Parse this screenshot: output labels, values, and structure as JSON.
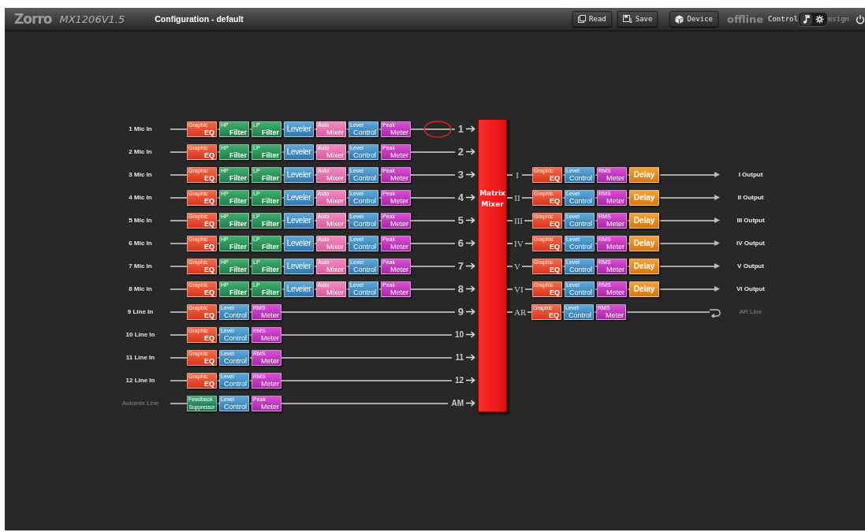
{
  "header": {
    "logo": "Zorro",
    "model": "MX1206V1.5",
    "title": "Configuration - default",
    "buttons": [
      {
        "kind": "read",
        "label": "Read"
      },
      {
        "kind": "save",
        "label": "Save"
      },
      {
        "kind": "device",
        "label": "Device"
      }
    ],
    "status": "offline",
    "mode_label": "Control",
    "toggle": [
      {
        "kind": "note",
        "selected": true
      },
      {
        "kind": "gear",
        "selected": false
      }
    ],
    "hidden_mode_label": "esign"
  },
  "inputs": [
    {
      "label": "1 Mic In",
      "number": "1",
      "circled": true,
      "dim": false,
      "blocks": [
        {
          "kind": "eq",
          "small": "Graphic",
          "big": "EQ"
        },
        {
          "kind": "filter",
          "small": "HP",
          "big": "Filter"
        },
        {
          "kind": "filter",
          "small": "LP",
          "big": "Filter"
        },
        {
          "kind": "leveler",
          "big": "Leveler"
        },
        {
          "kind": "auto",
          "small": "Auto",
          "big": "Mixer"
        },
        {
          "kind": "level",
          "small": "Level",
          "big": "Control"
        },
        {
          "kind": "meter",
          "small": "Peak",
          "big": "Meter"
        }
      ]
    },
    {
      "label": "2 Mic In",
      "number": "2",
      "circled": false,
      "dim": false,
      "blocks": [
        {
          "kind": "eq",
          "small": "Graphic",
          "big": "EQ"
        },
        {
          "kind": "filter",
          "small": "HP",
          "big": "Filter"
        },
        {
          "kind": "filter",
          "small": "LP",
          "big": "Filter"
        },
        {
          "kind": "leveler",
          "big": "Leveler"
        },
        {
          "kind": "auto",
          "small": "Auto",
          "big": "Mixer"
        },
        {
          "kind": "level",
          "small": "Level",
          "big": "Control"
        },
        {
          "kind": "meter",
          "small": "Peak",
          "big": "Meter"
        }
      ]
    },
    {
      "label": "3 Mic In",
      "number": "3",
      "circled": false,
      "dim": false,
      "blocks": [
        {
          "kind": "eq",
          "small": "Graphic",
          "big": "EQ"
        },
        {
          "kind": "filter",
          "small": "HP",
          "big": "Filter"
        },
        {
          "kind": "filter",
          "small": "LP",
          "big": "Filter"
        },
        {
          "kind": "leveler",
          "big": "Leveler"
        },
        {
          "kind": "auto",
          "small": "Auto",
          "big": "Mixer"
        },
        {
          "kind": "level",
          "small": "Level",
          "big": "Control"
        },
        {
          "kind": "meter",
          "small": "Peak",
          "big": "Meter"
        }
      ]
    },
    {
      "label": "4 Mic In",
      "number": "4",
      "circled": false,
      "dim": false,
      "blocks": [
        {
          "kind": "eq",
          "small": "Graphic",
          "big": "EQ"
        },
        {
          "kind": "filter",
          "small": "HP",
          "big": "Filter"
        },
        {
          "kind": "filter",
          "small": "LP",
          "big": "Filter"
        },
        {
          "kind": "leveler",
          "big": "Leveler"
        },
        {
          "kind": "auto",
          "small": "Auto",
          "big": "Mixer"
        },
        {
          "kind": "level",
          "small": "Level",
          "big": "Control"
        },
        {
          "kind": "meter",
          "small": "Peak",
          "big": "Meter"
        }
      ]
    },
    {
      "label": "5 Mic In",
      "number": "5",
      "circled": false,
      "dim": false,
      "blocks": [
        {
          "kind": "eq",
          "small": "Graphic",
          "big": "EQ"
        },
        {
          "kind": "filter",
          "small": "HP",
          "big": "Filter"
        },
        {
          "kind": "filter",
          "small": "LP",
          "big": "Filter"
        },
        {
          "kind": "leveler",
          "big": "Leveler"
        },
        {
          "kind": "auto",
          "small": "Auto",
          "big": "Mixer"
        },
        {
          "kind": "level",
          "small": "Level",
          "big": "Control"
        },
        {
          "kind": "meter",
          "small": "Peak",
          "big": "Meter"
        }
      ]
    },
    {
      "label": "6 Mic In",
      "number": "6",
      "circled": false,
      "dim": false,
      "blocks": [
        {
          "kind": "eq",
          "small": "Graphic",
          "big": "EQ"
        },
        {
          "kind": "filter",
          "small": "HP",
          "big": "Filter"
        },
        {
          "kind": "filter",
          "small": "LP",
          "big": "Filter"
        },
        {
          "kind": "leveler",
          "big": "Leveler"
        },
        {
          "kind": "auto",
          "small": "Auto",
          "big": "Mixer"
        },
        {
          "kind": "level",
          "small": "Level",
          "big": "Control"
        },
        {
          "kind": "meter",
          "small": "Peak",
          "big": "Meter"
        }
      ]
    },
    {
      "label": "7 Mic In",
      "number": "7",
      "circled": false,
      "dim": false,
      "blocks": [
        {
          "kind": "eq",
          "small": "Graphic",
          "big": "EQ"
        },
        {
          "kind": "filter",
          "small": "HP",
          "big": "Filter"
        },
        {
          "kind": "filter",
          "small": "LP",
          "big": "Filter"
        },
        {
          "kind": "leveler",
          "big": "Leveler"
        },
        {
          "kind": "auto",
          "small": "Auto",
          "big": "Mixer"
        },
        {
          "kind": "level",
          "small": "Level",
          "big": "Control"
        },
        {
          "kind": "meter",
          "small": "Peak",
          "big": "Meter"
        }
      ]
    },
    {
      "label": "8 Mic In",
      "number": "8",
      "circled": false,
      "dim": false,
      "blocks": [
        {
          "kind": "eq",
          "small": "Graphic",
          "big": "EQ"
        },
        {
          "kind": "filter",
          "small": "HP",
          "big": "Filter"
        },
        {
          "kind": "filter",
          "small": "LP",
          "big": "Filter"
        },
        {
          "kind": "leveler",
          "big": "Leveler"
        },
        {
          "kind": "auto",
          "small": "Auto",
          "big": "Mixer"
        },
        {
          "kind": "level",
          "small": "Level",
          "big": "Control"
        },
        {
          "kind": "meter",
          "small": "Peak",
          "big": "Meter"
        }
      ]
    },
    {
      "label": "9 Line In",
      "number": "9",
      "circled": false,
      "dim": false,
      "blocks": [
        {
          "kind": "eq",
          "small": "Graphic",
          "big": "EQ"
        },
        {
          "kind": "level",
          "small": "Level",
          "big": "Control"
        },
        {
          "kind": "meter",
          "small": "RMS",
          "big": "Meter"
        }
      ]
    },
    {
      "label": "10 Line In",
      "number": "10",
      "circled": false,
      "dim": false,
      "blocks": [
        {
          "kind": "eq",
          "small": "Graphic",
          "big": "EQ"
        },
        {
          "kind": "level",
          "small": "Level",
          "big": "Control"
        },
        {
          "kind": "meter",
          "small": "RMS",
          "big": "Meter"
        }
      ]
    },
    {
      "label": "11 Line In",
      "number": "11",
      "circled": false,
      "dim": false,
      "blocks": [
        {
          "kind": "eq",
          "small": "Graphic",
          "big": "EQ"
        },
        {
          "kind": "level",
          "small": "Level",
          "big": "Control"
        },
        {
          "kind": "meter",
          "small": "RMS",
          "big": "Meter"
        }
      ]
    },
    {
      "label": "12 Line In",
      "number": "12",
      "circled": false,
      "dim": false,
      "blocks": [
        {
          "kind": "eq",
          "small": "Graphic",
          "big": "EQ"
        },
        {
          "kind": "level",
          "small": "Level",
          "big": "Control"
        },
        {
          "kind": "meter",
          "small": "RMS",
          "big": "Meter"
        }
      ]
    },
    {
      "label": "Automix Line",
      "number": "AM",
      "circled": false,
      "dim": true,
      "blocks": [
        {
          "kind": "feedback",
          "small": "Feedback",
          "big": "Suppressor"
        },
        {
          "kind": "level",
          "small": "Level",
          "big": "Control"
        },
        {
          "kind": "meter",
          "small": "Peak",
          "big": "Meter"
        }
      ]
    }
  ],
  "matrix": {
    "line1": "Matrix",
    "line2": "Mixer"
  },
  "outputs": [
    {
      "number": "I",
      "label": "I Output",
      "kind": "arrow",
      "dim": false,
      "blocks": [
        {
          "kind": "eq",
          "small": "Graphic",
          "big": "EQ"
        },
        {
          "kind": "level",
          "small": "Level",
          "big": "Control"
        },
        {
          "kind": "meter",
          "small": "RMS",
          "big": "Meter"
        },
        {
          "kind": "delay",
          "big": "Delay"
        }
      ]
    },
    {
      "number": "II",
      "label": "II Output",
      "kind": "arrow",
      "dim": false,
      "blocks": [
        {
          "kind": "eq",
          "small": "Graphic",
          "big": "EQ"
        },
        {
          "kind": "level",
          "small": "Level",
          "big": "Control"
        },
        {
          "kind": "meter",
          "small": "RMS",
          "big": "Meter"
        },
        {
          "kind": "delay",
          "big": "Delay"
        }
      ]
    },
    {
      "number": "III",
      "label": "III Output",
      "kind": "arrow",
      "dim": false,
      "blocks": [
        {
          "kind": "eq",
          "small": "Graphic",
          "big": "EQ"
        },
        {
          "kind": "level",
          "small": "Level",
          "big": "Control"
        },
        {
          "kind": "meter",
          "small": "RMS",
          "big": "Meter"
        },
        {
          "kind": "delay",
          "big": "Delay"
        }
      ]
    },
    {
      "number": "IV",
      "label": "IV Output",
      "kind": "arrow",
      "dim": false,
      "blocks": [
        {
          "kind": "eq",
          "small": "Graphic",
          "big": "EQ"
        },
        {
          "kind": "level",
          "small": "Level",
          "big": "Control"
        },
        {
          "kind": "meter",
          "small": "RMS",
          "big": "Meter"
        },
        {
          "kind": "delay",
          "big": "Delay"
        }
      ]
    },
    {
      "number": "V",
      "label": "V Output",
      "kind": "arrow",
      "dim": false,
      "blocks": [
        {
          "kind": "eq",
          "small": "Graphic",
          "big": "EQ"
        },
        {
          "kind": "level",
          "small": "Level",
          "big": "Control"
        },
        {
          "kind": "meter",
          "small": "RMS",
          "big": "Meter"
        },
        {
          "kind": "delay",
          "big": "Delay"
        }
      ]
    },
    {
      "number": "VI",
      "label": "VI Output",
      "kind": "arrow",
      "dim": false,
      "blocks": [
        {
          "kind": "eq",
          "small": "Graphic",
          "big": "EQ"
        },
        {
          "kind": "level",
          "small": "Level",
          "big": "Control"
        },
        {
          "kind": "meter",
          "small": "RMS",
          "big": "Meter"
        },
        {
          "kind": "delay",
          "big": "Delay"
        }
      ]
    },
    {
      "number": "AR",
      "label": "AR Line",
      "kind": "return",
      "dim": true,
      "blocks": [
        {
          "kind": "eq",
          "small": "Graphic",
          "big": "EQ"
        },
        {
          "kind": "level",
          "small": "Level",
          "big": "Control"
        },
        {
          "kind": "meter",
          "small": "RMS",
          "big": "Meter"
        }
      ]
    }
  ]
}
